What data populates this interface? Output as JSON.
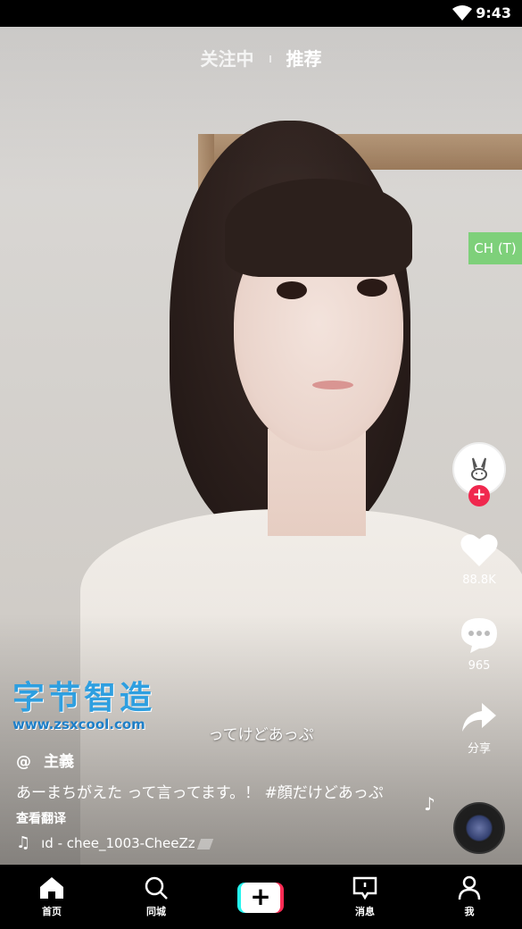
{
  "status_bar": {
    "time": "9:43",
    "wifi_icon": "wifi-icon"
  },
  "top_nav": {
    "following": "关注中",
    "recommended": "推荐"
  },
  "badge": {
    "label": "CH (T)",
    "color": "#7ed07a"
  },
  "side_actions": {
    "likes": "88.8K",
    "comments": "965",
    "share_label": "分享"
  },
  "watermark": {
    "title": "字节智造",
    "url": "www.zsxcool.com"
  },
  "subtitle": "ってけどあっぷ",
  "post": {
    "at": "@",
    "username": "主義",
    "description": "あーまちがえた って言ってます。！ #顔だけどあっぷ",
    "translate": "查看翻译",
    "music": "ıd - chee_1003-CheeZz"
  },
  "tabs": {
    "home": "首页",
    "city": "同城",
    "messages": "消息",
    "me": "我"
  },
  "colors": {
    "accent_red": "#fe2c55",
    "accent_cyan": "#25f4ee"
  }
}
